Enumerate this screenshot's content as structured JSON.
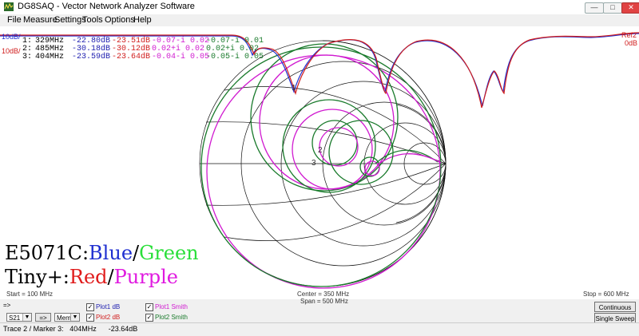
{
  "window": {
    "title": "DG8SAQ  -  Vector Network Analyzer Software",
    "min_label": "—",
    "max_label": "□",
    "close_label": "✕",
    "app_icon": "vna-app-icon"
  },
  "menu": [
    {
      "label": "File"
    },
    {
      "label": "Measure"
    },
    {
      "label": "Settings"
    },
    {
      "label": "Tools"
    },
    {
      "label": "Options"
    },
    {
      "label": "Help"
    }
  ],
  "plot": {
    "left_top_label": "10dB/",
    "left_red_label": "10dB/",
    "right_ref_label": "Ref2",
    "right_db_label": "0dB",
    "markers": [
      {
        "num": "1:",
        "freq": "329MHz",
        "v1": "-22.80dB",
        "v2": "-23.51dB",
        "z1": "-0.07-i 0.02",
        "z2": "-0.07-i 0.01"
      },
      {
        "num": "2:",
        "freq": "485MHz",
        "v1": "-30.18dB",
        "v2": "-30.12dB",
        "z1": "0.02+i 0.02",
        "z2": "0.02+i 0.02"
      },
      {
        "num": "3:",
        "freq": "404MHz",
        "v1": "-23.59dB",
        "v2": "-23.64dB",
        "z1": "-0.04-i 0.05",
        "z2": "-0.05-i 0.05"
      }
    ],
    "start_label": "Start = 100 MHz",
    "center_label": "Center = 350 MHz",
    "span_label": "Span = 500 MHz",
    "stop_label": "Stop = 600 MHz",
    "overlay_line1": {
      "prefix": "E5071C:",
      "blue": "Blue",
      "slash": "/",
      "green": "Green"
    },
    "overlay_line2": {
      "prefix": "Tiny+:",
      "red": "Red",
      "slash": "/",
      "purple": "Purple"
    },
    "colors": {
      "blue": "#1f2fd0",
      "green": "#1fa63a",
      "red": "#d01d1d",
      "purple": "#d01ad0",
      "darkgreen": "#197a2b",
      "blue_label": "#2020b0"
    }
  },
  "controls": {
    "arrow_label": "=>",
    "trace_select": "S21",
    "transfer_button": "=>",
    "memory_select": "Mem 1",
    "checks": [
      {
        "label": "Plot1  dB",
        "checked": "✓"
      },
      {
        "label": "Plot2  dB",
        "checked": "✓"
      },
      {
        "label": "Plot1  Smith",
        "checked": "✓"
      },
      {
        "label": "Plot2  Smith",
        "checked": "✓"
      }
    ],
    "continuous_button": "Continuous",
    "single_sweep_button": "Single Sweep"
  },
  "status": {
    "text": "Trace 2 / Marker 3:   404MHz      -23.64dB"
  }
}
